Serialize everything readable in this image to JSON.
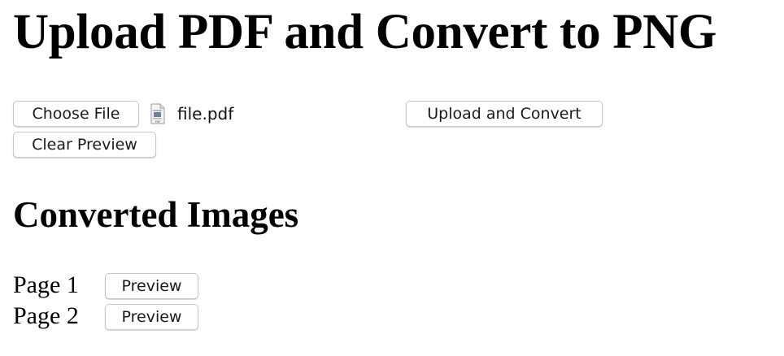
{
  "title": "Upload PDF and Convert to PNG",
  "upload_form": {
    "choose_file_label": "Choose File",
    "file_icon": "pdf-file-icon",
    "selected_file_name": "file.pdf",
    "upload_button_label": "Upload and Convert",
    "clear_preview_label": "Clear Preview"
  },
  "results": {
    "heading": "Converted Images",
    "pages": [
      {
        "label": "Page 1",
        "button_label": "Preview"
      },
      {
        "label": "Page 2",
        "button_label": "Preview"
      }
    ]
  }
}
